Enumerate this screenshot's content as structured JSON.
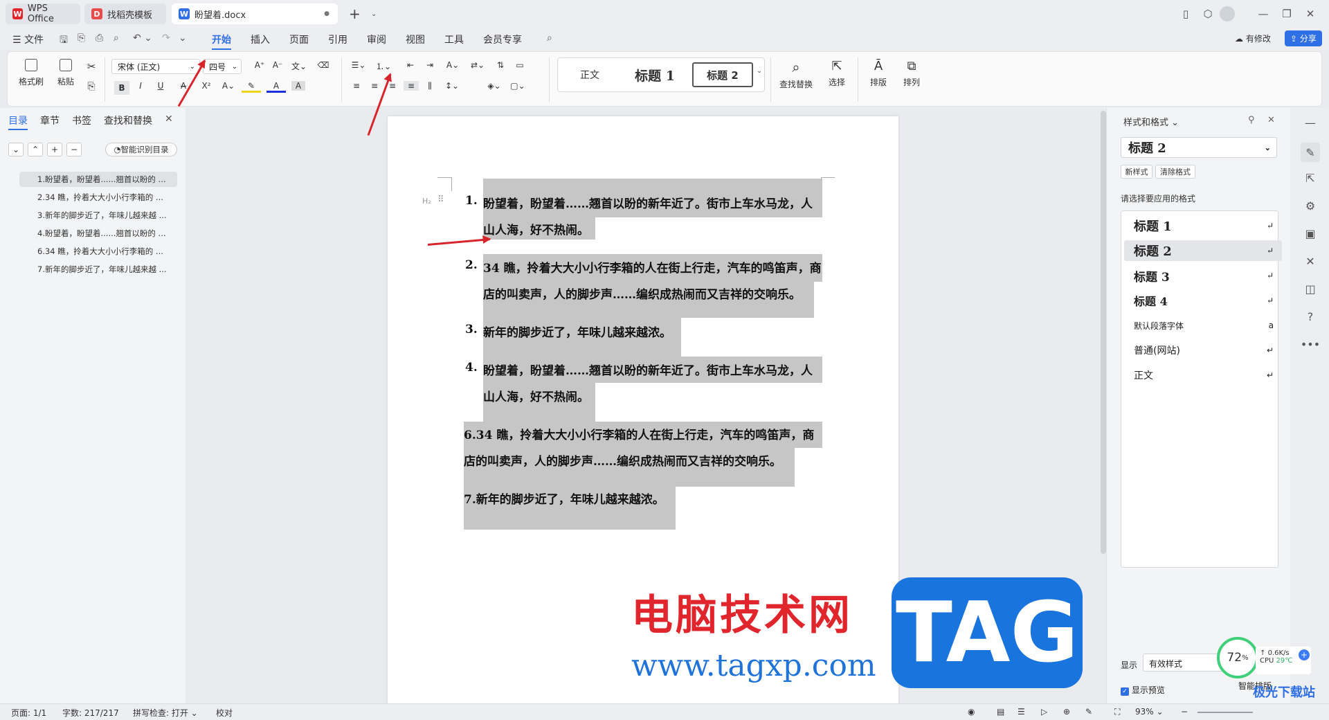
{
  "titlebar": {
    "tabs": [
      {
        "label": "WPS Office"
      },
      {
        "label": "找稻壳模板"
      },
      {
        "label": "盼望着.docx"
      }
    ],
    "new_tab": "+"
  },
  "menubar": {
    "file": "文件",
    "items": [
      "开始",
      "插入",
      "页面",
      "引用",
      "审阅",
      "视图",
      "工具",
      "会员专享"
    ],
    "active": "开始",
    "modified": "有修改",
    "share": "分享"
  },
  "ribbon": {
    "format_painter": "格式刷",
    "paste": "粘贴",
    "font_name": "宋体 (正文)",
    "font_size": "四号",
    "style_gallery": [
      "正文",
      "标题 1",
      "标题 2"
    ],
    "find_replace": "查找替换",
    "select": "选择",
    "layout": "排版",
    "arrange": "排列",
    "bold": "B",
    "italic": "I",
    "underline": "U"
  },
  "leftpanel": {
    "tabs": [
      "目录",
      "章节",
      "书签",
      "查找和替换"
    ],
    "smart_toc": "智能识别目录",
    "toc": [
      "1.盼望着，盼望着......翘首以盼的 ...",
      "2.34 瞧，拎着大大小小行李箱的 ...",
      "3.新年的脚步近了，年味儿越来越 ...",
      "4.盼望着，盼望着......翘首以盼的 ...",
      "6.34 瞧，拎着大大小小行李箱的 ...",
      "7.新年的脚步近了，年味儿越来越 ..."
    ]
  },
  "document": {
    "heading_marker": "H₂",
    "items": [
      {
        "num": "1.",
        "lines": [
          "盼望着，盼望着……翘首以盼的新年近了。街市上车水马龙，人",
          "山人海，好不热闹。"
        ]
      },
      {
        "num": "2.",
        "lines": [
          "34 瞧，拎着大大小小行李箱的人在街上行走，汽车的鸣笛声，商",
          "店的叫卖声，人的脚步声……编织成热闹而又吉祥的交响乐。"
        ]
      },
      {
        "num": "3.",
        "lines": [
          "新年的脚步近了，年味儿越来越浓。"
        ]
      },
      {
        "num": "4.",
        "lines": [
          "盼望着，盼望着……翘首以盼的新年近了。街市上车水马龙，人",
          "山人海，好不热闹。"
        ]
      }
    ],
    "plain": [
      "6.34 瞧，拎着大大小小行李箱的人在街上行走，汽车的鸣笛声，商",
      "店的叫卖声，人的脚步声……编织成热闹而又吉祥的交响乐。",
      "7.新年的脚步近了，年味儿越来越浓。"
    ]
  },
  "watermark": {
    "cn": "电脑技术网",
    "url": "www.tagxp.com",
    "tag": "TAG",
    "corner": "极光下载站"
  },
  "rightpanel": {
    "title": "样式和格式",
    "current": "标题 2",
    "new_style": "新样式",
    "clear_format": "清除格式",
    "prompt": "请选择要应用的格式",
    "styles": [
      "标题 1",
      "标题 2",
      "标题 3",
      "标题 4",
      "默认段落字体",
      "普通(网站)",
      "正文"
    ],
    "show_label": "显示",
    "show_value": "有效样式",
    "preview": "显示预览",
    "smart_layout": "智能排版"
  },
  "monitor": {
    "percent": "72",
    "unit": "%",
    "speed": "0.6K/s",
    "cpu": "CPU",
    "temp": "29℃"
  },
  "statusbar": {
    "page": "页面: 1/1",
    "words": "字数: 217/217",
    "spell": "拼写检查: 打开",
    "proof": "校对",
    "zoom": "93%"
  },
  "colors": {
    "accent": "#2f6fe6",
    "arrow": "#d8252b",
    "highlight": "#c6c6c6",
    "watermark_red": "#e0262c",
    "watermark_blue": "#1f73d9"
  }
}
